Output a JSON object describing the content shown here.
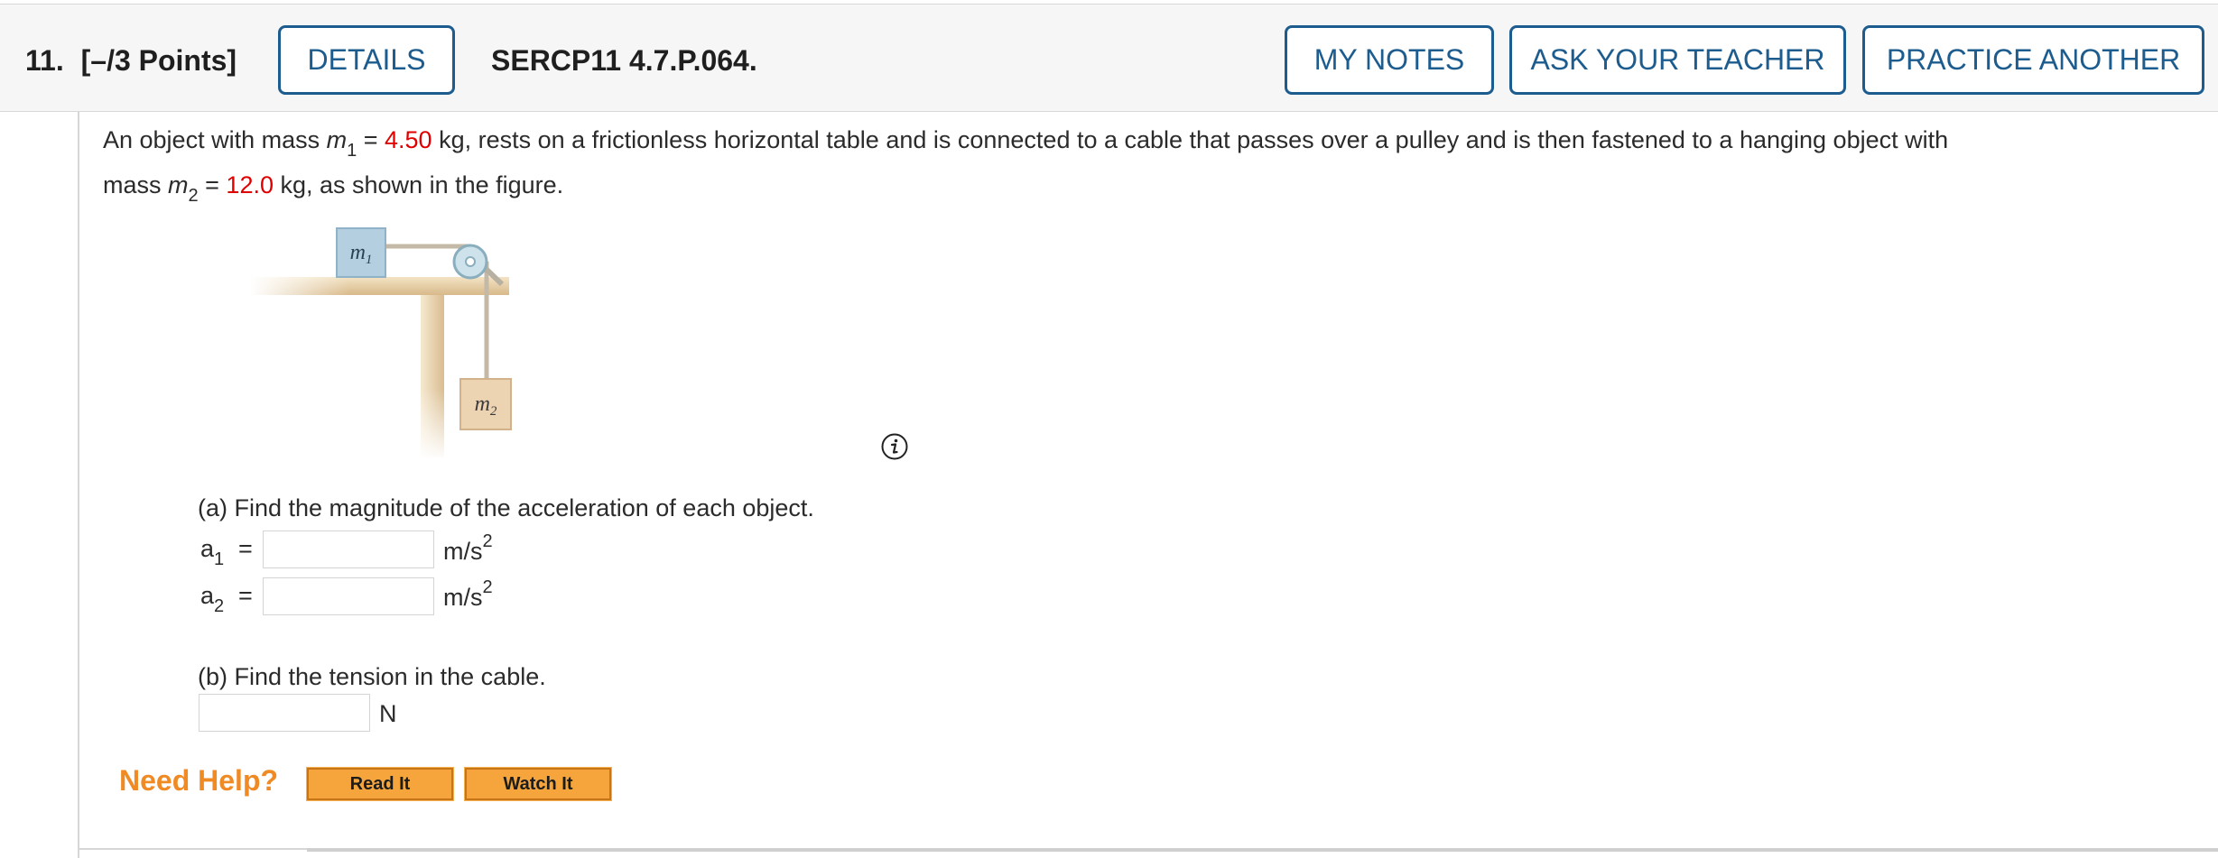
{
  "question": {
    "number": "11.",
    "points": "[–/3 Points]",
    "details_button": "DETAILS",
    "code": "SERCP11 4.7.P.064.",
    "actions": {
      "my_notes": "MY NOTES",
      "ask_teacher": "ASK YOUR TEACHER",
      "practice_another": "PRACTICE ANOTHER"
    }
  },
  "problem": {
    "line1_start": "An object with mass ",
    "m1_symbol": "m",
    "m1_sub": "1",
    "equals": " = ",
    "m1_value": "4.50",
    "line1_end": " kg, rests on a frictionless horizontal table and is connected to a cable that passes over a pulley and is then fastened to a hanging object with",
    "line2_start": "mass ",
    "m2_symbol": "m",
    "m2_sub": "2",
    "m2_value": "12.0",
    "line2_end": " kg, as shown in the figure."
  },
  "figure": {
    "label_m1": "m1",
    "label_m2": "m2"
  },
  "part_a": {
    "prompt": "(a) Find the magnitude of the acceleration of each object.",
    "a1_symbol": "a",
    "a1_sub": "1",
    "a2_symbol": "a",
    "a2_sub": "2",
    "equals": "=",
    "unit": "m/s",
    "unit_sup": "2",
    "a1_value": "",
    "a2_value": ""
  },
  "part_b": {
    "prompt": "(b) Find the tension in the cable.",
    "unit": "N",
    "value": ""
  },
  "help": {
    "title": "Need Help?",
    "read_it": "Read It",
    "watch_it": "Watch It"
  },
  "colors": {
    "accent_blue": "#1d5c8e",
    "value_red": "#e00000",
    "help_orange": "#f08a24",
    "help_button": "#f6a53c"
  }
}
